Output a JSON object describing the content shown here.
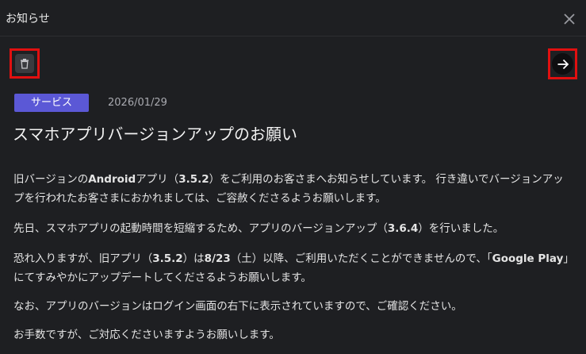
{
  "dialog": {
    "title": "お知らせ",
    "close_icon": "close-icon"
  },
  "toolbar": {
    "delete_icon": "trash-icon",
    "next_icon": "arrow-right-icon",
    "highlight_color": "#e01010"
  },
  "notice": {
    "category": "サービス",
    "category_color": "#5b58d6",
    "date": "2026/01/29",
    "headline": "スマホアプリバージョンアップのお願い",
    "paragraphs": {
      "p1": {
        "a": "旧バージョンの",
        "b": "Android",
        "c": "アプリ（",
        "d": "3.5.2",
        "e": "）をご利用のお客さまへお知らせしています。 行き違いでバージョンアップを行われたお客さまにおかれましては、ご容赦くださるようお願いします。"
      },
      "p2": {
        "a": "先日、スマホアプリの起動時間を短縮するため、アプリのバージョンアップ（",
        "b": "3.6.4",
        "c": "）を行いました。"
      },
      "p3": {
        "a": "恐れ入りますが、旧アプリ（",
        "b": "3.5.2",
        "c": "）は",
        "d": "8/23",
        "e": "（土）以降、ご利用いただくことができませんので、「",
        "f": "Google Play",
        "g": "」にてすみやかにアップデートしてくださるようお願いします。"
      },
      "p4": "なお、アプリのバージョンはログイン画面の右下に表示されていますので、ご確認ください。",
      "p5": "お手数ですが、ご対応くださいますようお願いします。"
    }
  }
}
